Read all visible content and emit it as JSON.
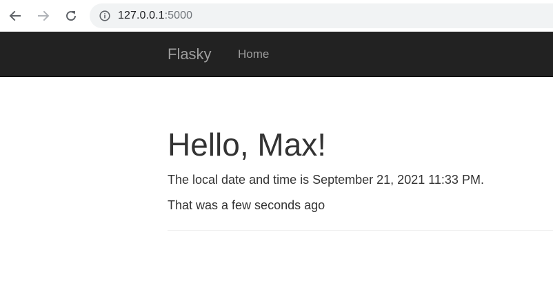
{
  "browser": {
    "back_icon": "arrow-left-icon",
    "forward_icon": "arrow-right-icon",
    "reload_icon": "reload-icon",
    "info_icon": "info-icon",
    "url_host": "127.0.0.1",
    "url_port": ":5000"
  },
  "navbar": {
    "brand": "Flasky",
    "links": [
      {
        "label": "Home"
      }
    ],
    "background": "#222222",
    "text_color": "#9d9d9d"
  },
  "main": {
    "title": "Hello, Max!",
    "date_line": "The local date and time is September 21, 2021 11:33 PM.",
    "relative_line": "That was a few seconds ago"
  }
}
